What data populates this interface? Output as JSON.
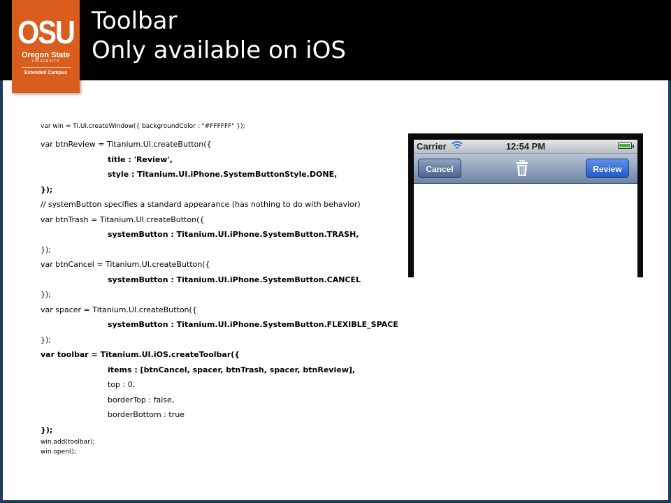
{
  "slide": {
    "title_line1": "Toolbar",
    "title_line2": "Only available on iOS"
  },
  "logo": {
    "big": "OSU",
    "line1": "Oregon State",
    "line2": "UNIVERSITY",
    "line3": "Extended Campus"
  },
  "code_lines": [
    "var win = Ti.UI.createWindow({ backgroundColor : \"#FFFFFF\" });",
    "var btnReview = Titanium.UI.createButton({",
    "title : 'Review',",
    "style : Titanium.UI.iPhone.SystemButtonStyle.DONE,",
    "});",
    "// systemButton specifies a standard appearance (has nothing to do with behavior)",
    "var btnTrash = Titanium.UI.createButton({",
    "systemButton : Titanium.UI.iPhone.SystemButton.TRASH,",
    "});",
    "var btnCancel = Titanium.UI.createButton({",
    "systemButton : Titanium.UI.iPhone.SystemButton.CANCEL",
    "});",
    "var spacer = Titanium.UI.createButton({",
    "systemButton : Titanium.UI.iPhone.SystemButton.FLEXIBLE_SPACE",
    "});",
    "var toolbar = Titanium.UI.iOS.createToolbar({",
    "items : [btnCancel, spacer, btnTrash, spacer, btnReview],",
    "top : 0,",
    "borderTop : false,",
    "borderBottom : true",
    "});",
    "win.add(toolbar);",
    "win.open();"
  ],
  "phone": {
    "carrier": "Carrier",
    "time": "12:54 PM",
    "cancel_label": "Cancel",
    "review_label": "Review",
    "battery_level": 1.0
  },
  "colors": {
    "header_bg": "#000000",
    "logo_bg": "#d95e1e",
    "frame": "#1f3a5a",
    "review_button": "#2f6ee0"
  },
  "icons": [
    "trash-icon",
    "wifi-icon",
    "battery-icon"
  ]
}
